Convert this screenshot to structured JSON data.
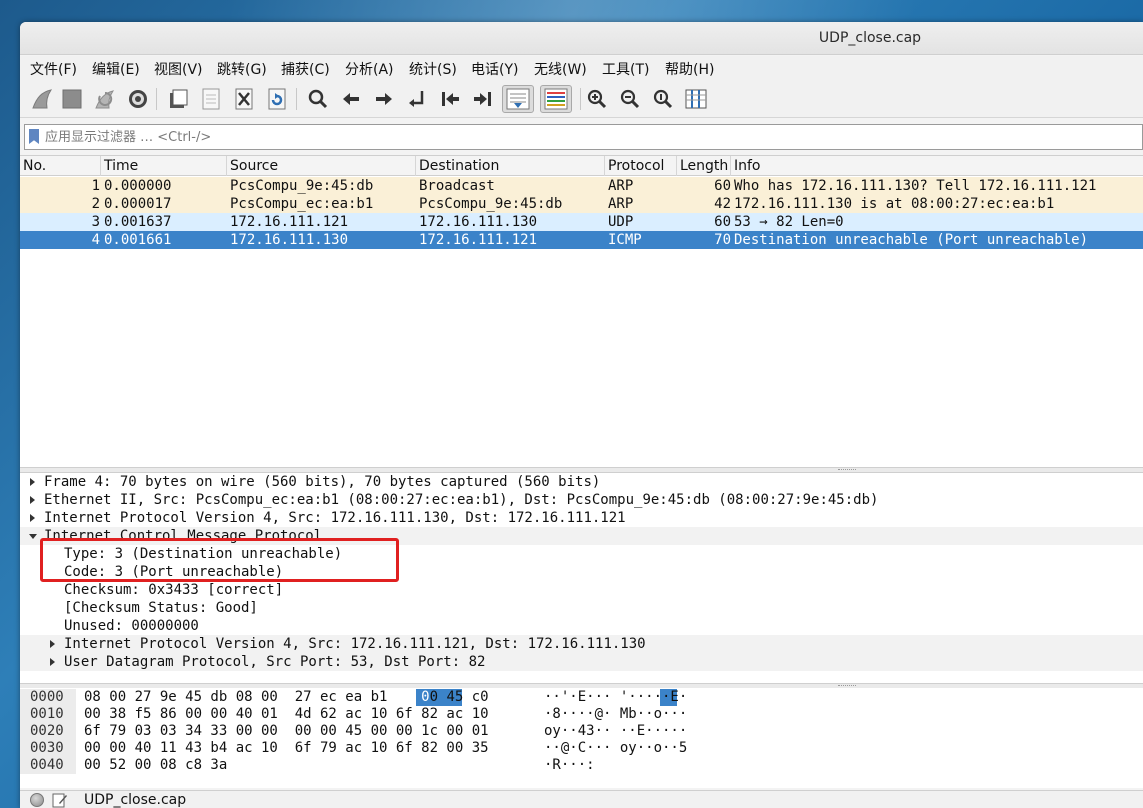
{
  "window": {
    "title": "UDP_close.cap"
  },
  "menu": [
    "文件(F)",
    "编辑(E)",
    "视图(V)",
    "跳转(G)",
    "捕获(C)",
    "分析(A)",
    "统计(S)",
    "电话(Y)",
    "无线(W)",
    "工具(T)",
    "帮助(H)"
  ],
  "toolbar": {
    "icons": [
      "shark-fin-start-icon",
      "stop-square-icon",
      "restart-fin-icon",
      "capture-options-gear-icon",
      "open-folder-icon",
      "save-file-icon",
      "close-file-icon",
      "reload-file-icon",
      "search-packet-icon",
      "go-back-arrow-icon",
      "go-forward-arrow-icon",
      "go-to-packet-icon",
      "first-packet-icon",
      "last-packet-icon",
      "autoscroll-icon",
      "colorize-icon",
      "zoom-in-icon",
      "zoom-out-icon",
      "normal-size-icon",
      "resize-columns-icon"
    ]
  },
  "filter": {
    "placeholder": "应用显示过滤器 … <Ctrl-/>",
    "value": ""
  },
  "packet_list": {
    "columns": [
      "No.",
      "Time",
      "Source",
      "Destination",
      "Protocol",
      "Length",
      "Info"
    ],
    "rows": [
      {
        "no": "1",
        "time": "0.000000",
        "source": "PcsCompu_9e:45:db",
        "destination": "Broadcast",
        "protocol": "ARP",
        "length": "60",
        "info": "Who has 172.16.111.130? Tell 172.16.111.121",
        "bg": "#faf0d7",
        "fg": "#111111"
      },
      {
        "no": "2",
        "time": "0.000017",
        "source": "PcsCompu_ec:ea:b1",
        "destination": "PcsCompu_9e:45:db",
        "protocol": "ARP",
        "length": "42",
        "info": "172.16.111.130 is at 08:00:27:ec:ea:b1",
        "bg": "#faf0d7",
        "fg": "#111111"
      },
      {
        "no": "3",
        "time": "0.001637",
        "source": "172.16.111.121",
        "destination": "172.16.111.130",
        "protocol": "UDP",
        "length": "60",
        "info": "53 → 82 Len=0",
        "bg": "#daeeff",
        "fg": "#111111"
      },
      {
        "no": "4",
        "time": "0.001661",
        "source": "172.16.111.130",
        "destination": "172.16.111.121",
        "protocol": "ICMP",
        "length": "70",
        "info": "Destination unreachable (Port unreachable)",
        "bg": "#3b83c9",
        "fg": "#ffffff",
        "selected": true
      }
    ]
  },
  "details": {
    "rows": [
      {
        "text": "Frame 4: 70 bytes on wire (560 bits), 70 bytes captured (560 bits)",
        "level": 0,
        "state": "collapsed"
      },
      {
        "text": "Ethernet II, Src: PcsCompu_ec:ea:b1 (08:00:27:ec:ea:b1), Dst: PcsCompu_9e:45:db (08:00:27:9e:45:db)",
        "level": 0,
        "state": "collapsed"
      },
      {
        "text": "Internet Protocol Version 4, Src: 172.16.111.130, Dst: 172.16.111.121",
        "level": 0,
        "state": "collapsed"
      },
      {
        "text": "Internet Control Message Protocol",
        "level": 0,
        "state": "expanded"
      },
      {
        "text": "Type: 3 (Destination unreachable)",
        "level": 1,
        "state": "leaf"
      },
      {
        "text": "Code: 3 (Port unreachable)",
        "level": 1,
        "state": "leaf"
      },
      {
        "text": "Checksum: 0x3433 [correct]",
        "level": 1,
        "state": "leaf"
      },
      {
        "text": "[Checksum Status: Good]",
        "level": 1,
        "state": "leaf"
      },
      {
        "text": "Unused: 00000000",
        "level": 1,
        "state": "leaf"
      },
      {
        "text": "Internet Protocol Version 4, Src: 172.16.111.121, Dst: 172.16.111.130",
        "level": 1,
        "state": "collapsed"
      },
      {
        "text": "User Datagram Protocol, Src Port: 53, Dst Port: 82",
        "level": 1,
        "state": "collapsed"
      }
    ],
    "highlight_color": "#e02020"
  },
  "hex": {
    "rows": [
      {
        "offset": "0000",
        "bytes": "08 00 27 9e 45 db 08 00  27 ec ea b1 08 00 45 c0",
        "ascii": "··'·E··· '·····E·"
      },
      {
        "offset": "0010",
        "bytes": "00 38 f5 86 00 00 40 01  4d 62 ac 10 6f 82 ac 10",
        "ascii": "·8····@· Mb··o···"
      },
      {
        "offset": "0020",
        "bytes": "6f 79 03 03 34 33 00 00  00 00 45 00 00 1c 00 01",
        "ascii": "oy··43·· ··E·····"
      },
      {
        "offset": "0030",
        "bytes": "00 00 40 11 43 b4 ac 10  6f 79 ac 10 6f 82 00 35",
        "ascii": "··@·C··· oy··o··5"
      },
      {
        "offset": "0040",
        "bytes": "00 52 00 08 c8 3a",
        "ascii": "·R···:"
      }
    ],
    "selection_color": "#3b83c9"
  },
  "status": {
    "file": "UDP_close.cap"
  }
}
